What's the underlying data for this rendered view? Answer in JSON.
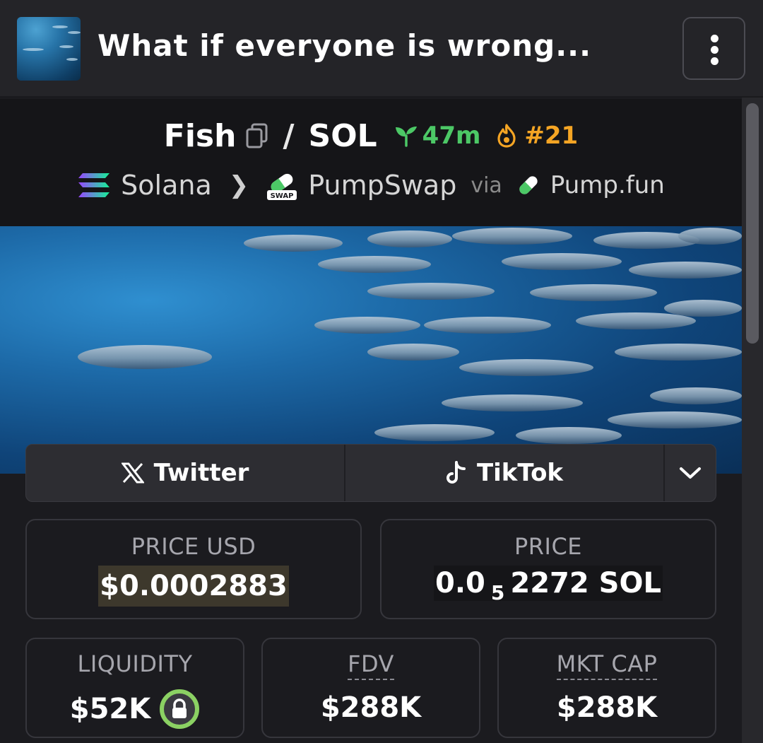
{
  "header": {
    "title": "What if everyone is wrong..."
  },
  "token": {
    "base_symbol": "Fish",
    "slash": "/",
    "quote_symbol": "SOL",
    "age": "47m",
    "rank": "#21",
    "chain": "Solana",
    "dex": "PumpSwap",
    "via_label": "via",
    "launchpad": "Pump.fun"
  },
  "social": {
    "twitter_label": "Twitter",
    "tiktok_label": "TikTok"
  },
  "stats": {
    "price_usd": {
      "label": "PRICE USD",
      "value": "$0.0002883"
    },
    "price_native": {
      "label": "PRICE",
      "prefix": "0.0",
      "sub_zeros": "5",
      "digits": "2272",
      "unit": "SOL"
    },
    "liquidity": {
      "label": "LIQUIDITY",
      "value": "$52K"
    },
    "fdv": {
      "label": "FDV",
      "value": "$288K"
    },
    "mkt_cap": {
      "label": "MKT CAP",
      "value": "$288K"
    }
  },
  "colors": {
    "age_green": "#4cc866",
    "rank_orange": "#f5a524",
    "lock_ring": "#8bd163"
  },
  "icons": [
    "token-thumbnail",
    "more-vertical-icon",
    "copy-icon",
    "sprout-icon",
    "flame-icon",
    "solana-logo-icon",
    "pumpswap-icon",
    "pill-icon",
    "x-logo-icon",
    "tiktok-icon",
    "chevron-down-icon",
    "lock-icon"
  ]
}
